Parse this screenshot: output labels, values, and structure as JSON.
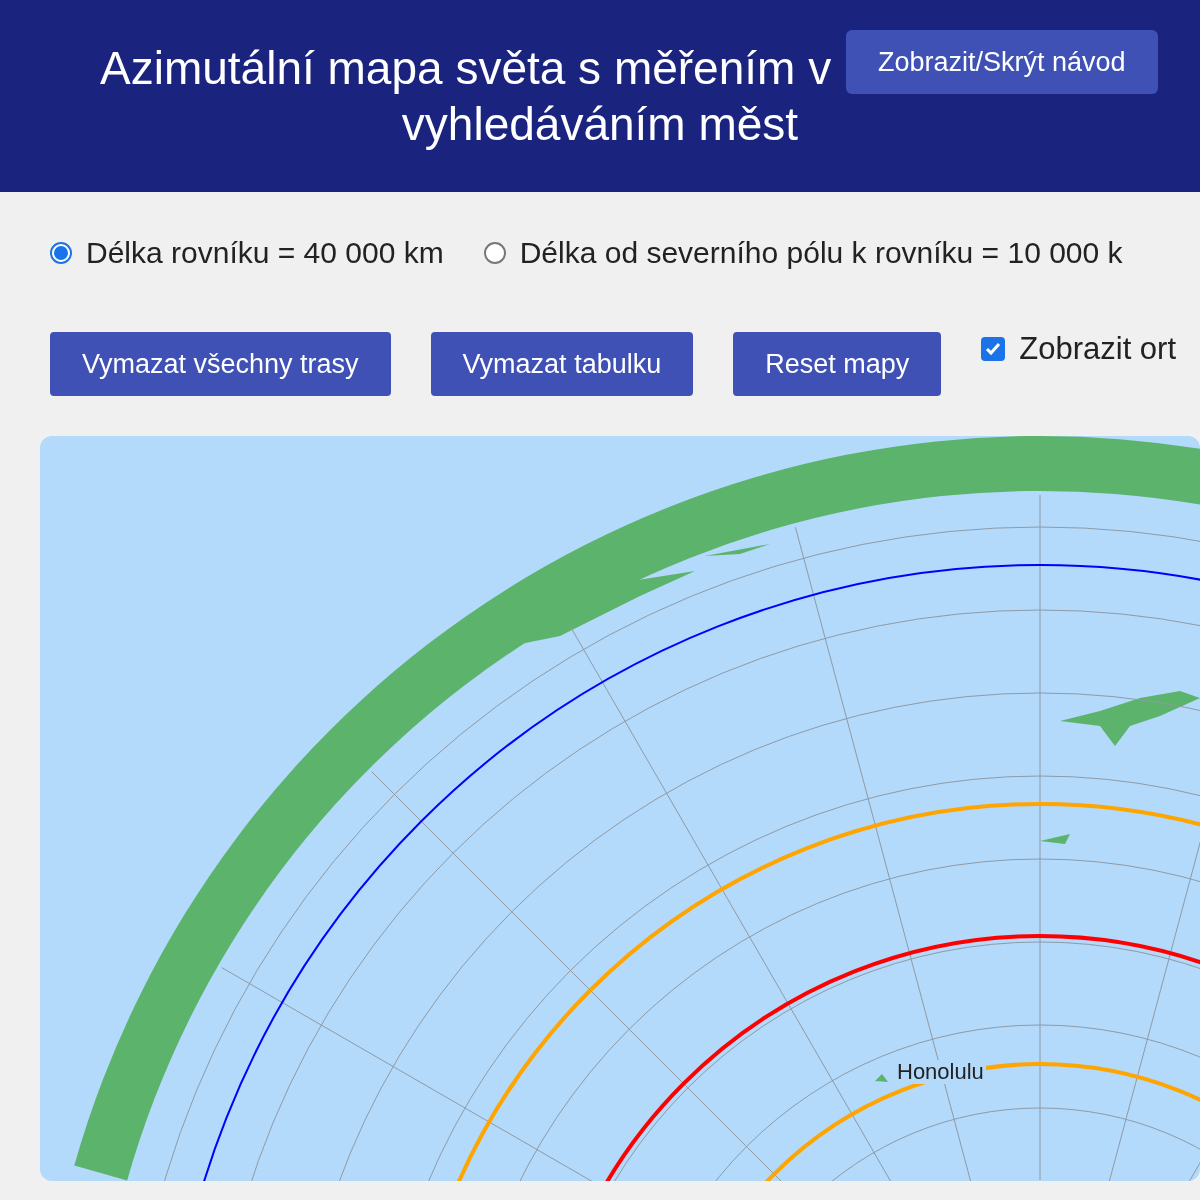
{
  "header": {
    "title_lines": [
      "Azimutální mapa světa s měřením v",
      "vyhledáváním měst"
    ],
    "guide_button": "Zobrazit/Skrýt návod"
  },
  "units": [
    {
      "label": "Délka rovníku = 40 000 km",
      "selected": true
    },
    {
      "label": "Délka od severního pólu k rovníku = 10 000 k",
      "selected": false
    }
  ],
  "actions": [
    "Vymazat všechny trasy",
    "Vymazat tabulku",
    "Reset mapy"
  ],
  "toggle": {
    "label": "Zobrazit ort",
    "checked": true
  },
  "map": {
    "circles": [
      {
        "color": "#0000ff"
      },
      {
        "color": "#ffa500"
      },
      {
        "color": "#ff0000"
      },
      {
        "color": "#ffa500"
      }
    ],
    "cities": [
      {
        "name": "Honolulu"
      }
    ]
  }
}
